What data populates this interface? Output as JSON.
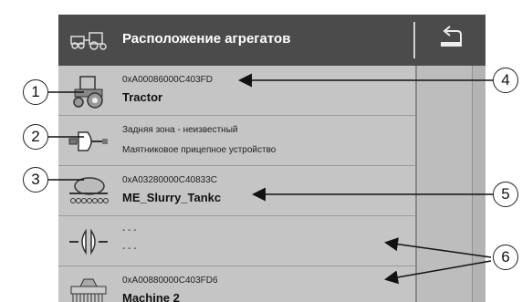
{
  "header": {
    "title": "Расположение агрегатов",
    "icon": "machines-icon",
    "back_icon": "back-arrow-icon"
  },
  "rows": [
    {
      "icon": "tractor-icon",
      "line1": "0xA00086000C403FD",
      "line2": "Tractor"
    },
    {
      "icon": "hitch-icon",
      "line1": "Задняя зона - неизвестный",
      "line2": "Маятниковое прицепное устройство"
    },
    {
      "icon": "slurry-tank-icon",
      "line1": "0xA03280000C40833C",
      "line2": "ME_Slurry_Tankc"
    },
    {
      "icon": "connector-icon",
      "line1": "- - -",
      "line2": "- - -"
    },
    {
      "icon": "seeder-icon",
      "line1": "0xA00880000C403FD6",
      "line2": "Machine 2"
    }
  ],
  "callouts": [
    "1",
    "2",
    "3",
    "4",
    "5",
    "6"
  ],
  "colors": {
    "header_bg": "#4b4b4b",
    "list_bg": "#c5c5c5",
    "sidebar_bg": "#b4b4b4"
  }
}
